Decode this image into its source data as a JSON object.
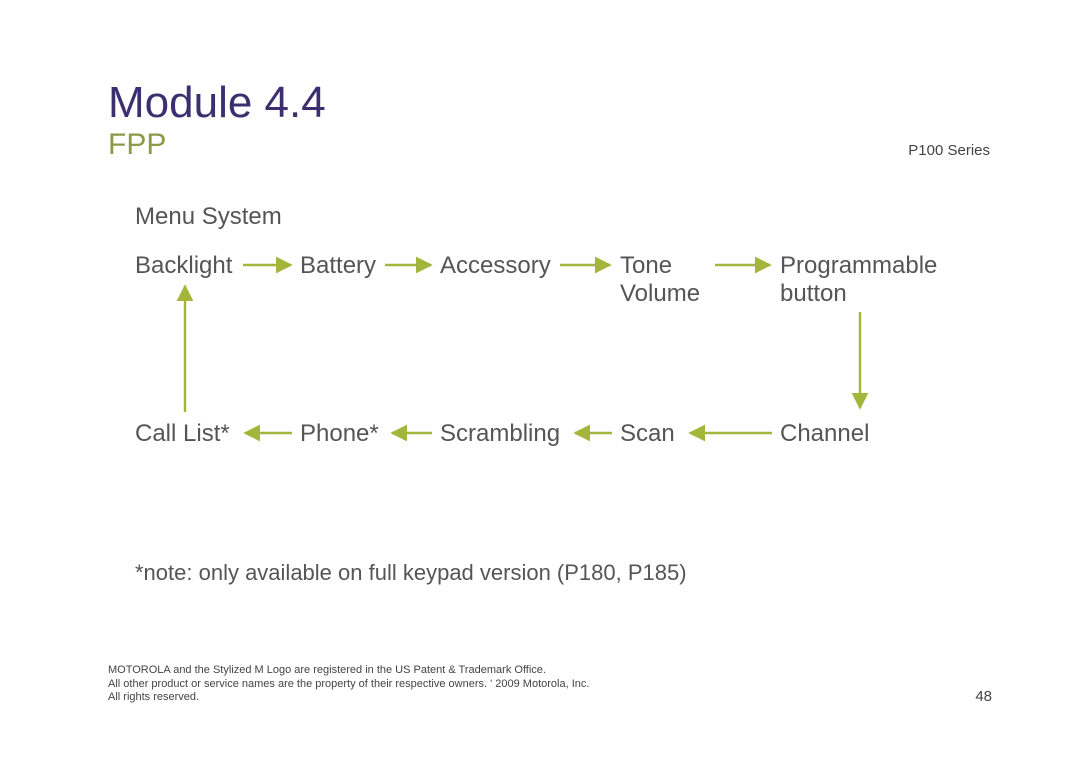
{
  "title": "Module 4.4",
  "subtitle": "FPP",
  "series": "P100 Series",
  "heading": "Menu System",
  "nodes": {
    "backlight": "Backlight",
    "battery": "Battery",
    "accessory": "Accessory",
    "tone": "Tone\nVolume",
    "prog": "Programmable\nbutton",
    "calllist": "Call List*",
    "phone": "Phone*",
    "scrambling": "Scrambling",
    "scan": "Scan",
    "channel": "Channel"
  },
  "note": "*note: only available on full keypad version (P180, P185)",
  "footer_lines": [
    "MOTOROLA and the Stylized M Logo are registered in the US Patent & Trademark Office.",
    "All other product or service names are the property of their respective owners. ' 2009 Motorola, Inc.",
    "All rights reserved."
  ],
  "page_number": "48",
  "arrow_color": "#a3b63b"
}
